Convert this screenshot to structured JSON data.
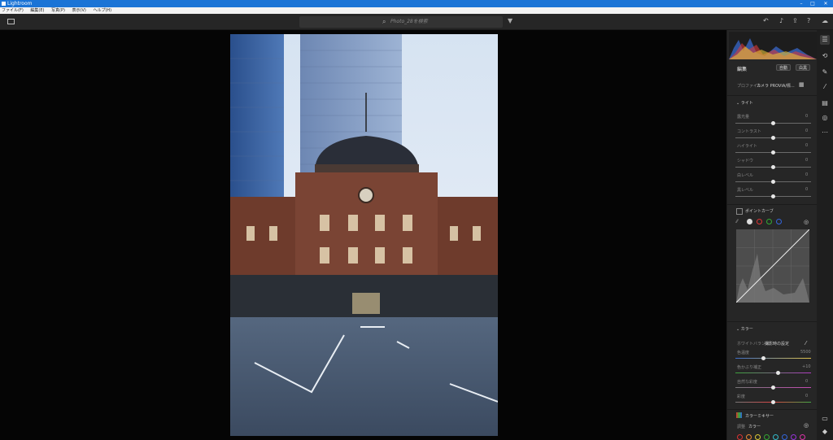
{
  "window": {
    "title": "Lightroom",
    "controls": [
      "–",
      "□",
      "✕"
    ]
  },
  "menu": [
    "ファイル(F)",
    "編集(E)",
    "写真(P)",
    "表示(V)",
    "ヘルプ(H)"
  ],
  "toolbar": {
    "search_placeholder": "Photo_28を検索"
  },
  "panel": {
    "title": "編集",
    "auto_label": "自動",
    "bw_label": "白黒",
    "profile_label": "プロファイル",
    "profile_value": "カメラ PROVIA/標...",
    "light": {
      "header": "ライト",
      "sliders": [
        {
          "label": "露光量",
          "value": "0",
          "pos": 0.5
        },
        {
          "label": "コントラスト",
          "value": "0",
          "pos": 0.5
        },
        {
          "label": "ハイライト",
          "value": "0",
          "pos": 0.5
        },
        {
          "label": "シャドウ",
          "value": "0",
          "pos": 0.5
        },
        {
          "label": "白レベル",
          "value": "0",
          "pos": 0.5
        },
        {
          "label": "黒レベル",
          "value": "0",
          "pos": 0.5
        }
      ]
    },
    "point_curve": {
      "header": "ポイントカーブ"
    },
    "color": {
      "header": "カラー",
      "wb_label": "ホワイトバランス",
      "wb_value": "撮影時の設定",
      "sliders": [
        {
          "label": "色温度",
          "value": "5500",
          "pos": 0.35
        },
        {
          "label": "色かぶり補正",
          "value": "+10",
          "pos": 0.55
        },
        {
          "label": "自然な彩度",
          "value": "0",
          "pos": 0.5
        },
        {
          "label": "彩度",
          "value": "0",
          "pos": 0.5
        }
      ]
    },
    "color_mixer": {
      "header": "カラーミキサー",
      "adjust_label": "調整",
      "adjust_value": "カラー"
    }
  }
}
